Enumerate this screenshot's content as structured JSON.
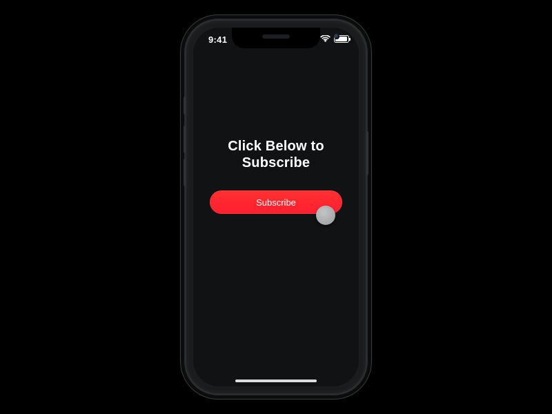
{
  "status_bar": {
    "time": "9:41"
  },
  "content": {
    "headline_line1": "Click Below to",
    "headline_line2": "Subscribe",
    "subscribe_label": "Subscribe"
  }
}
